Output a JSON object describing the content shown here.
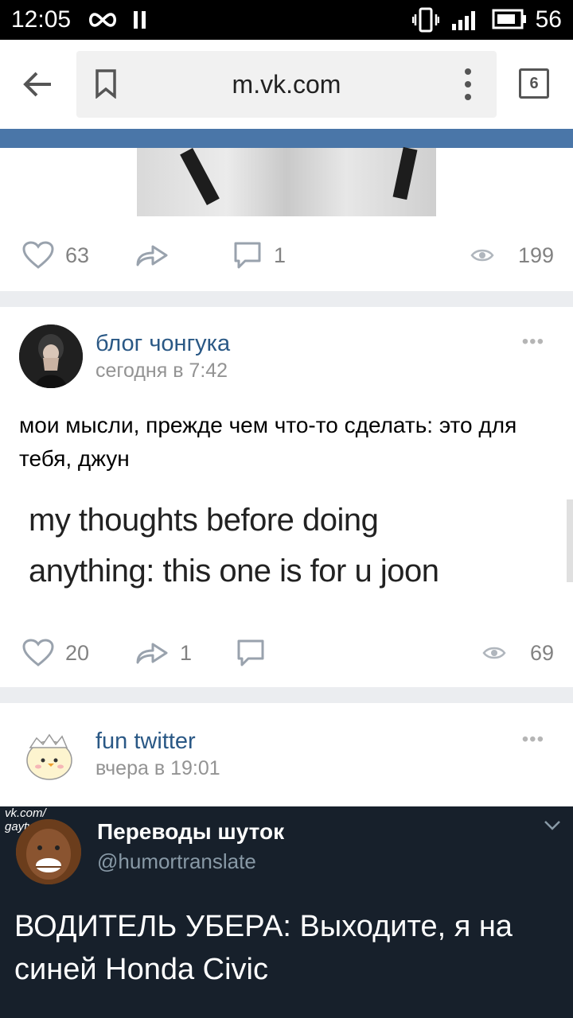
{
  "status_bar": {
    "time": "12:05",
    "battery_level": "56"
  },
  "browser": {
    "url": "m.vk.com",
    "tab_count": "6"
  },
  "posts": [
    {
      "likes": "63",
      "shares": "",
      "comments": "1",
      "views": "199"
    },
    {
      "author": "блог чонгука",
      "date": "сегодня в 7:42",
      "text": "мои мысли, прежде чем что-то сделать: это для тебя, джун",
      "image_lines": [
        "my thoughts before doing",
        "anything: this one is for u joon"
      ],
      "likes": "20",
      "shares": "1",
      "comments": "",
      "views": "69"
    },
    {
      "author": "fun twitter",
      "date": "вчера в 19:01"
    }
  ],
  "tweet_image": {
    "watermark": "vk.com/\ngaytwitter",
    "name": "Переводы шуток",
    "handle": "@humortranslate",
    "text": "ВОДИТЕЛЬ УБЕРА: Выходите, я на синей Honda Civic"
  },
  "colors": {
    "vk_blue": "#4a76a8",
    "link": "#2a5885",
    "meta": "#828282",
    "tweet_bg": "#17202b"
  }
}
